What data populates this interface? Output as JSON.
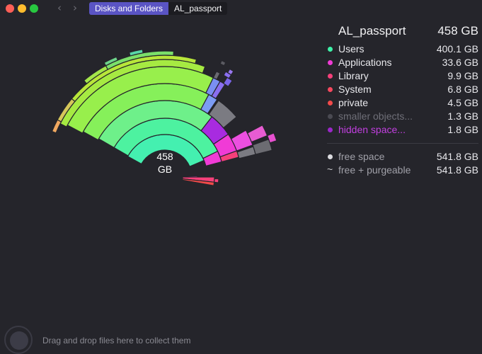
{
  "window": {
    "breadcrumb": [
      "Disks and Folders",
      "AL_passport"
    ]
  },
  "center_label": {
    "line1": "458",
    "line2": "GB"
  },
  "panel": {
    "title": "AL_passport",
    "total": "458 GB",
    "items": [
      {
        "name": "Users",
        "size": "400.1 GB",
        "color": "#3ef2a8"
      },
      {
        "name": "Applications",
        "size": "33.6 GB",
        "color": "#f03bd6"
      },
      {
        "name": "Library",
        "size": "9.9 GB",
        "color": "#f5407a"
      },
      {
        "name": "System",
        "size": "6.8 GB",
        "color": "#f5485e"
      },
      {
        "name": "private",
        "size": "4.5 GB",
        "color": "#f34a4a"
      },
      {
        "name": "smaller objects...",
        "size": "1.3 GB",
        "color": "#4a4a52",
        "name_color": "#6f6f78"
      },
      {
        "name": "hidden space...",
        "size": "1.8 GB",
        "color": "#9b27c9",
        "name_color": "#c23fe0"
      }
    ],
    "free": [
      {
        "marker": "dot",
        "name": "free space",
        "size": "541.8 GB",
        "color": "#dcdce0"
      },
      {
        "marker": "~",
        "name": "free + purgeable",
        "size": "541.8 GB"
      }
    ]
  },
  "footer": {
    "drop_hint": "Drag and drop files here to collect them"
  }
}
